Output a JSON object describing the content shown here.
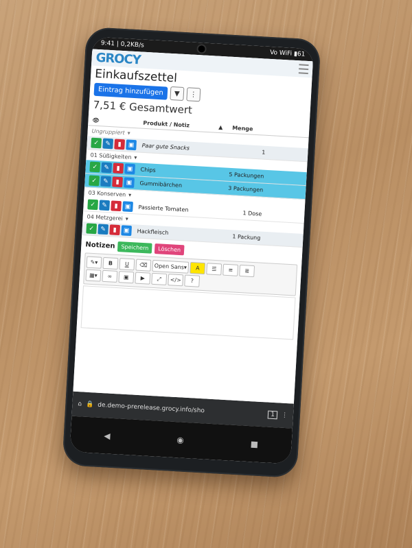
{
  "status": {
    "time_net": "9:41 | 0,2KB/s",
    "signal": "Vo WiFi",
    "battery": "61"
  },
  "app": {
    "logo": "GROCY",
    "page_title": "Einkaufszettel"
  },
  "actions": {
    "add_label": "Eintrag hinzufügen",
    "filter_glyph": "▼",
    "more_glyph": "⋮"
  },
  "summary": {
    "total": "7,51 € Gesamtwert"
  },
  "table": {
    "col_product": "Produkt / Notiz",
    "col_amount": "Menge",
    "eye_glyph": "👁",
    "sort_glyph": "▲"
  },
  "groups": [
    {
      "label": "Ungruppiert",
      "items": [
        {
          "name": "Paar gute Snacks",
          "amount": "1"
        }
      ]
    },
    {
      "label": "01 Süßigkeiten",
      "items": [
        {
          "name": "Chips",
          "amount": "5 Packungen"
        },
        {
          "name": "Gummibärchen",
          "amount": "3 Packungen"
        }
      ]
    },
    {
      "label": "03 Konserven",
      "items": [
        {
          "name": "Passierte Tomaten",
          "amount": "1 Dose"
        }
      ]
    },
    {
      "label": "04 Metzgerei",
      "items": [
        {
          "name": "Hackfleisch",
          "amount": "1 Packung"
        }
      ]
    }
  ],
  "notes": {
    "title": "Notizen",
    "save": "Speichern",
    "delete": "Löschen"
  },
  "editor": {
    "bold": "B",
    "underline": "U",
    "font": "Open Sans",
    "color": "A",
    "help": "?",
    "code": "</>"
  },
  "browser": {
    "url": "de.demo-prerelease.grocy.info/sho",
    "tabs": "1"
  }
}
